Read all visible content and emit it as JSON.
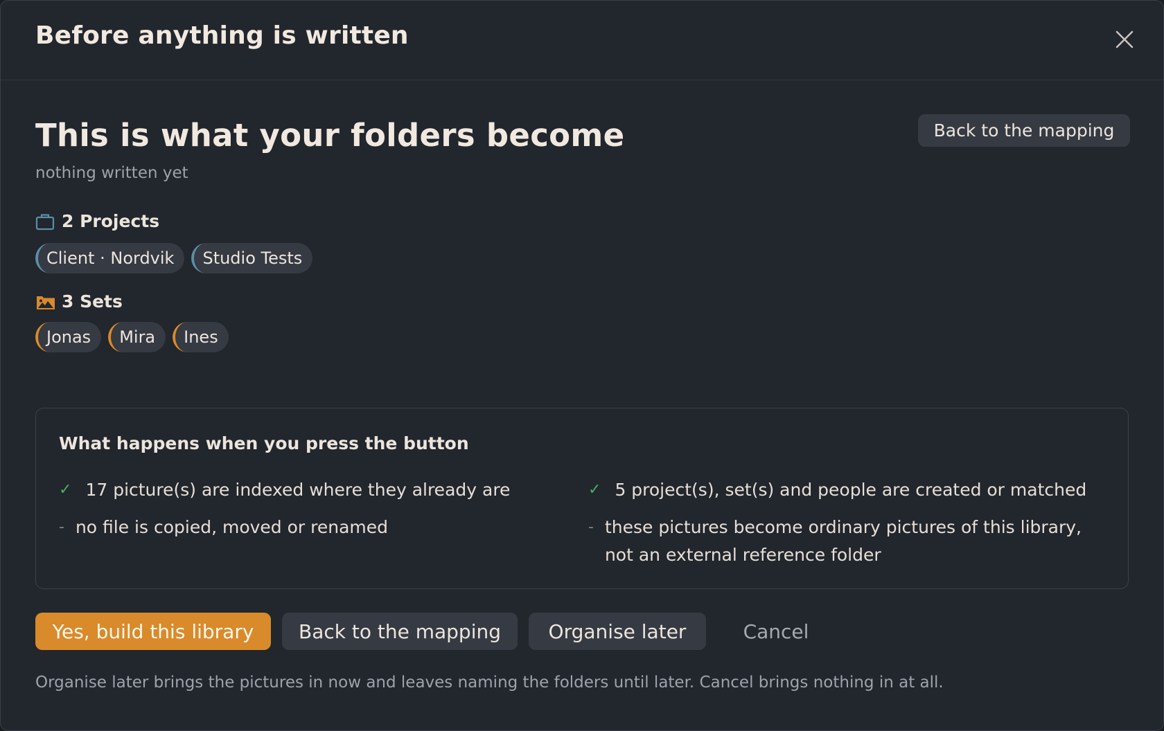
{
  "dialog": {
    "title": "Before anything is written",
    "close_label": "close"
  },
  "summary": {
    "headline": "This is what your folders become",
    "subline": "nothing written yet",
    "back_button": "Back to the mapping"
  },
  "projects": {
    "heading": "2 Projects",
    "icon": "briefcase-icon",
    "accent": "#5b8fa6",
    "items": [
      "Client · Nordvik",
      "Studio Tests"
    ]
  },
  "sets": {
    "heading": "3 Sets",
    "icon": "folder-images-icon",
    "accent": "#d98a2a",
    "items": [
      "Jonas",
      "Mira",
      "Ines"
    ]
  },
  "info": {
    "title": "What happens when you press the button",
    "left": [
      {
        "mark": "✓",
        "text": "17 picture(s) are indexed where they already are"
      },
      {
        "mark": "-",
        "text": "no file is copied, moved or renamed"
      }
    ],
    "right": [
      {
        "mark": "✓",
        "text": "5 project(s), set(s) and people are created or matched"
      },
      {
        "mark": "-",
        "text": "these pictures become ordinary pictures of this library, not an external reference folder"
      }
    ]
  },
  "actions": {
    "primary": "Yes, build this library",
    "back": "Back to the mapping",
    "later": "Organise later",
    "cancel": "Cancel"
  },
  "footnote": "Organise later brings the pictures in now and leaves naming the folders until later. Cancel brings nothing in at all.",
  "colors": {
    "accent": "#d98a2a",
    "check": "#4caf62",
    "background": "#22262d"
  }
}
